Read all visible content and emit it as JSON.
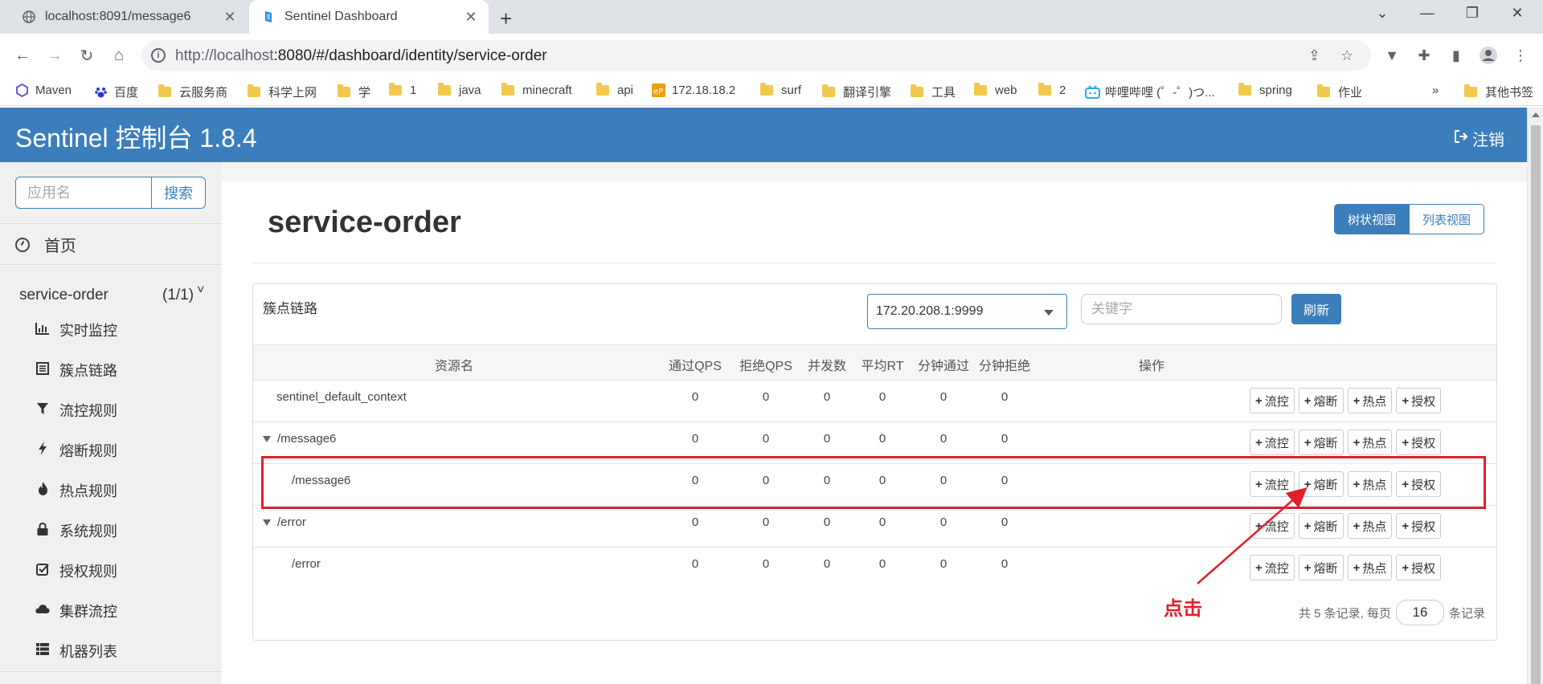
{
  "browser": {
    "tabs": [
      {
        "title": "localhost:8091/message6",
        "active": false
      },
      {
        "title": "Sentinel Dashboard",
        "active": true
      }
    ],
    "url_host": "http://localhost",
    "url_rest": ":8080/#/dashboard/identity/service-order",
    "bookmarks": [
      "Maven",
      "百度",
      "云服务商",
      "科学上网",
      "学",
      "1",
      "java",
      "minecraft",
      "api",
      "172.18.18.2",
      "surf",
      "翻译引擎",
      "工具",
      "web",
      "2",
      "哔哩哔哩 (゜-゜)つ...",
      "spring",
      "作业"
    ],
    "more_bookmarks": "»",
    "other_bookmarks": "其他书签"
  },
  "app": {
    "brand": "Sentinel 控制台 1.8.4",
    "logout": "注销",
    "accent": "#3c7ebc"
  },
  "sidebar": {
    "search_placeholder": "应用名",
    "search_button": "搜索",
    "home": "首页",
    "app_name": "service-order",
    "app_count": "(1/1)",
    "menu": [
      {
        "label": "实时监控",
        "icon": "bar-chart-icon"
      },
      {
        "label": "簇点链路",
        "icon": "list-icon"
      },
      {
        "label": "流控规则",
        "icon": "filter-icon"
      },
      {
        "label": "熔断规则",
        "icon": "bolt-icon"
      },
      {
        "label": "热点规则",
        "icon": "fire-icon"
      },
      {
        "label": "系统规则",
        "icon": "lock-icon"
      },
      {
        "label": "授权规则",
        "icon": "check-square-icon"
      },
      {
        "label": "集群流控",
        "icon": "cloud-icon"
      },
      {
        "label": "机器列表",
        "icon": "th-list-icon"
      }
    ]
  },
  "main": {
    "title": "service-order",
    "view_tree": "树状视图",
    "view_list": "列表视图",
    "panel_title": "簇点链路",
    "machine": "172.20.208.1:9999",
    "keyword_placeholder": "关键字",
    "refresh": "刷新",
    "columns": [
      "资源名",
      "通过QPS",
      "拒绝QPS",
      "并发数",
      "平均RT",
      "分钟通过",
      "分钟拒绝",
      "操作"
    ],
    "op_labels": [
      "流控",
      "熔断",
      "热点",
      "授权"
    ],
    "rows": [
      {
        "name": "sentinel_default_context",
        "level": 0,
        "toggle": false,
        "values": [
          "0",
          "0",
          "0",
          "0",
          "0",
          "0"
        ]
      },
      {
        "name": "/message6",
        "level": 0,
        "toggle": true,
        "values": [
          "0",
          "0",
          "0",
          "0",
          "0",
          "0"
        ]
      },
      {
        "name": "/message6",
        "level": 1,
        "toggle": false,
        "values": [
          "0",
          "0",
          "0",
          "0",
          "0",
          "0"
        ]
      },
      {
        "name": "/error",
        "level": 0,
        "toggle": true,
        "values": [
          "0",
          "0",
          "0",
          "0",
          "0",
          "0"
        ]
      },
      {
        "name": "/error",
        "level": 1,
        "toggle": false,
        "values": [
          "0",
          "0",
          "0",
          "0",
          "0",
          "0"
        ]
      }
    ],
    "pager_prefix": "共 5 条记录, 每页",
    "page_size": "16",
    "pager_suffix": "条记录"
  },
  "annotation": {
    "text": "点击",
    "color": "#e0202a"
  }
}
